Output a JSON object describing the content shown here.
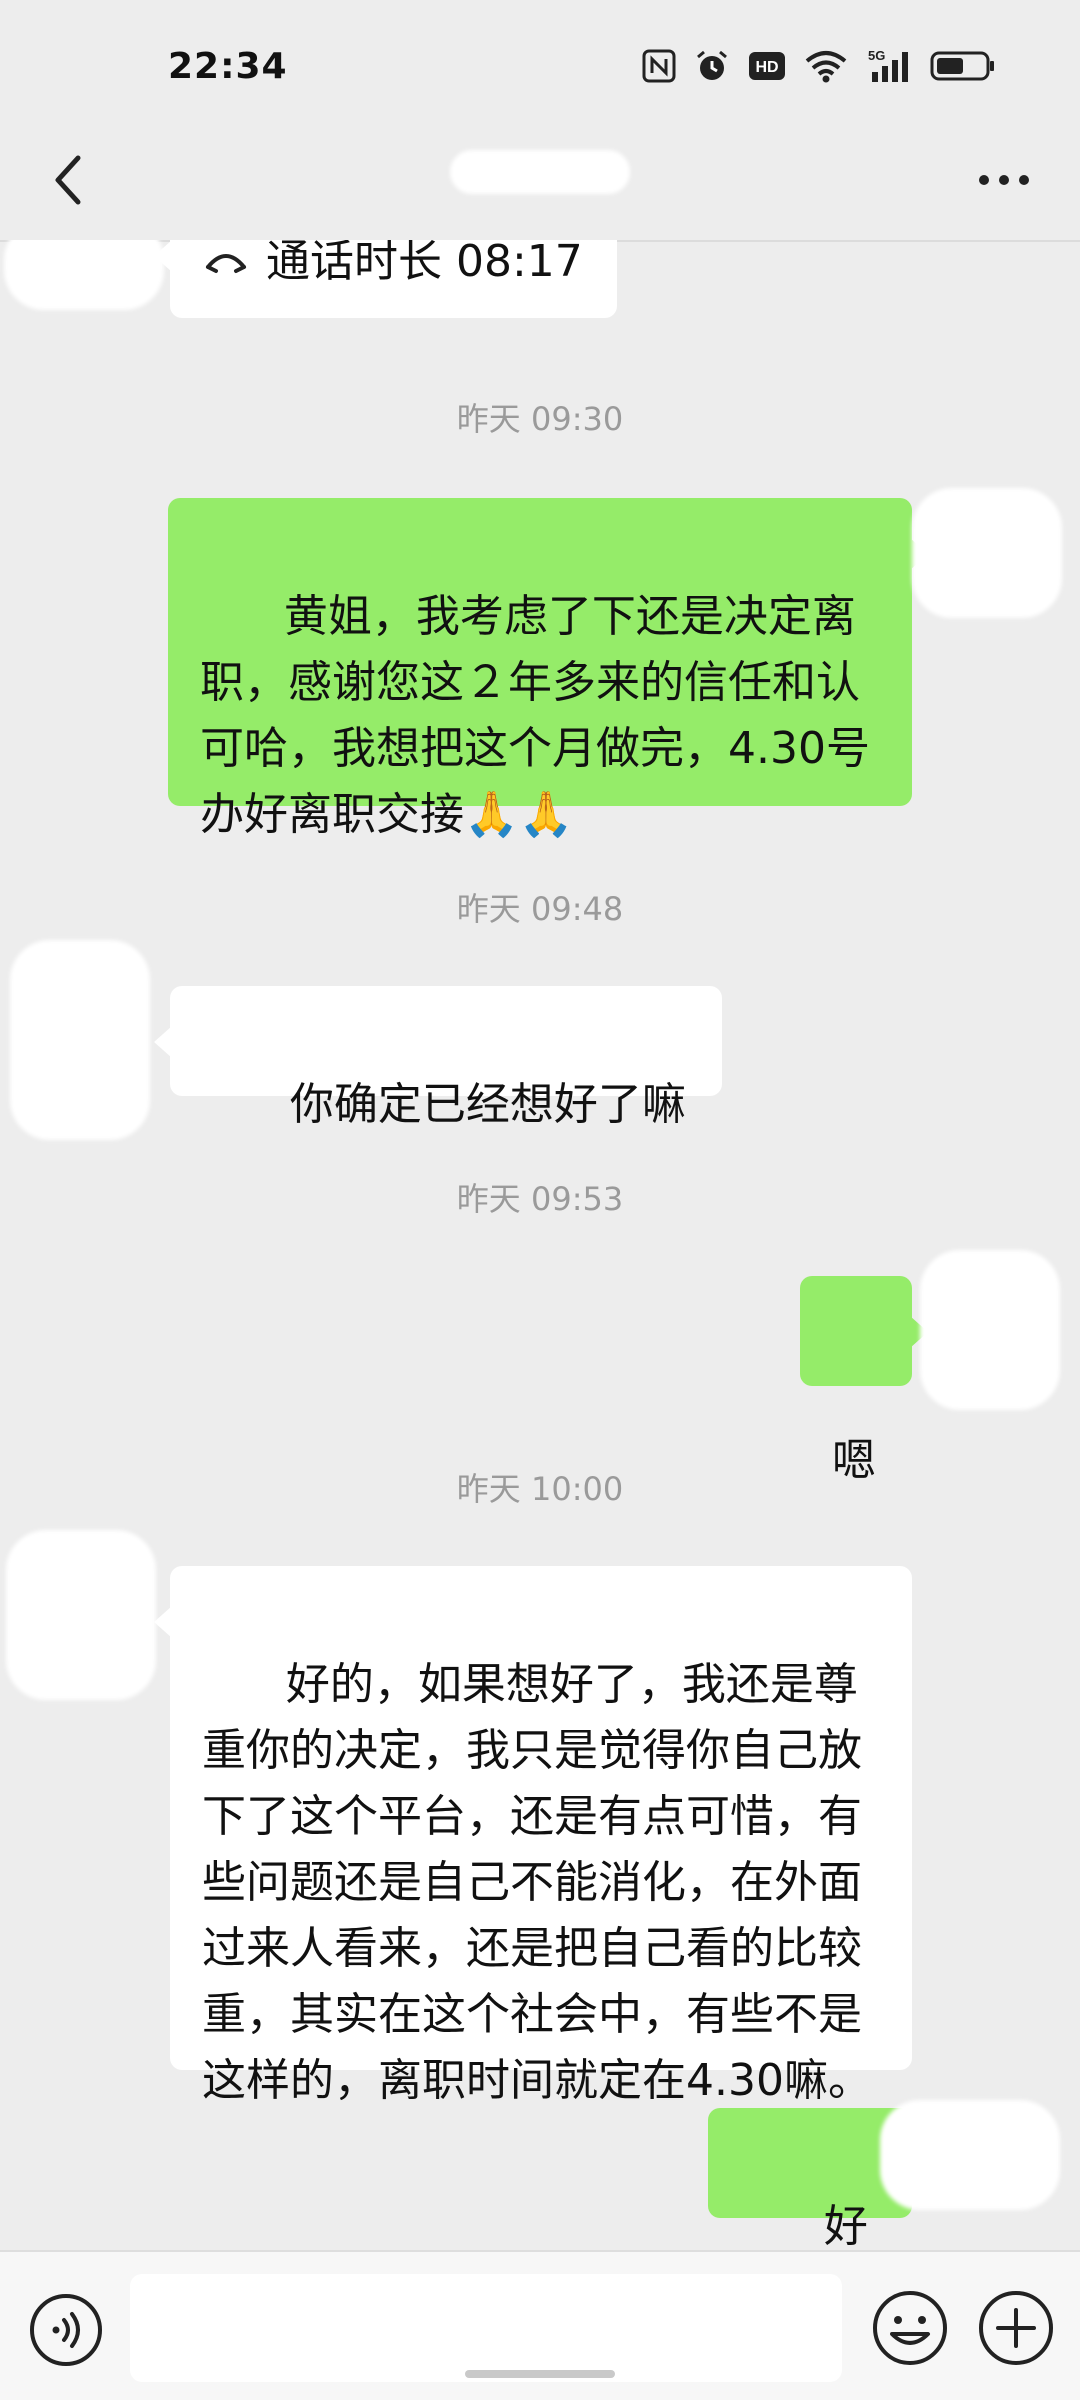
{
  "status_bar": {
    "time": "22:34",
    "network": "5G",
    "hd_label": "HD",
    "nfc_label": "N"
  },
  "chat": {
    "call_record": "通话时长 08:17",
    "messages": [
      {
        "type": "timestamp",
        "text": "昨天 09:30"
      },
      {
        "type": "sent",
        "text": "黄姐，我考虑了下还是决定离职，感谢您这２年多来的信任和认可哈，我想把这个月做完，4.30号办好离职交接"
      },
      {
        "type": "timestamp",
        "text": "昨天 09:48"
      },
      {
        "type": "received",
        "text": "你确定已经想好了嘛"
      },
      {
        "type": "timestamp",
        "text": "昨天 09:53"
      },
      {
        "type": "sent",
        "text": "嗯"
      },
      {
        "type": "timestamp",
        "text": "昨天 10:00"
      },
      {
        "type": "received",
        "text": "好的，如果想好了，我还是尊重你的决定，我只是觉得你自己放下了这个平台，还是有点可惜，有些问题还是自己不能消化，在外面过来人看来，还是把自己看的比较重，其实在这个社会中，有些不是这样的，离职时间就定在4.30嘛。"
      },
      {
        "type": "sent",
        "text": "好的哈"
      }
    ]
  },
  "composer": {
    "placeholder": ""
  },
  "icons": {
    "back": "chevron-left-icon",
    "more": "more-horizontal-icon",
    "voice": "voice-icon",
    "emoji": "emoji-icon",
    "plus": "plus-icon",
    "call": "phone-call-icon",
    "pray": "folded-hands-emoji"
  },
  "colors": {
    "background": "#ededed",
    "sent_bubble": "#95ec69",
    "received_bubble": "#ffffff",
    "timestamp": "#9a9a9a"
  }
}
